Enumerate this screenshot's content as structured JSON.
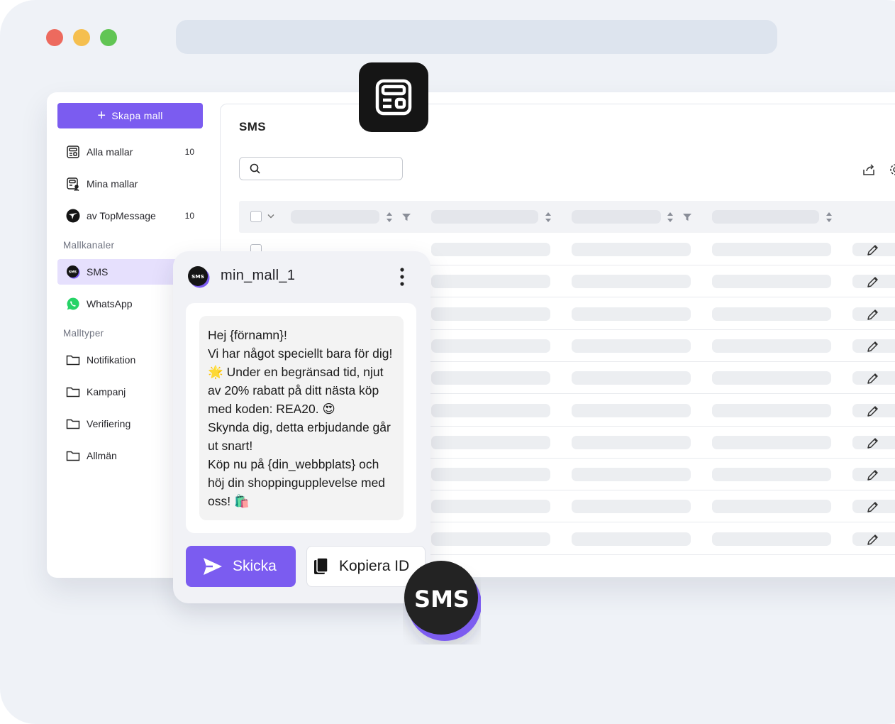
{
  "sidebar": {
    "create_label": "Skapa mall",
    "items": [
      {
        "label": "Alla mallar",
        "count": "10"
      },
      {
        "label": "Mina mallar"
      },
      {
        "label": "av TopMessage",
        "count": "10"
      }
    ],
    "channels_label": "Mallkanaler",
    "channels": [
      {
        "label": "SMS",
        "icon_text": "SMS"
      },
      {
        "label": "WhatsApp"
      }
    ],
    "types_label": "Malltyper",
    "types": [
      {
        "label": "Notifikation"
      },
      {
        "label": "Kampanj"
      },
      {
        "label": "Verifiering"
      },
      {
        "label": "Allmän"
      }
    ]
  },
  "main": {
    "title": "SMS",
    "search_value": "",
    "search_placeholder": "",
    "row_count": 10
  },
  "card": {
    "avatar_text": "SMS",
    "title": "min_mall_1",
    "message": "Hej {förnamn}!\nVi har något speciellt bara för dig! 🌟 Under en begränsad tid, njut av 20% rabatt på ditt nästa köp med koden: REA20. 😍\nSkynda dig, detta erbjudande går ut snart!\nKöp nu på {din_webbplats} och höj din shoppingupplevelse med oss! 🛍️",
    "send_label": "Skicka",
    "copy_label": "Kopiera ID"
  },
  "badge": {
    "text": "SMS"
  },
  "colors": {
    "accent": "#7b5cf0",
    "accent_light": "#e6e0fd",
    "background": "#eff2f7",
    "dark": "#151515",
    "whatsapp": "#25d366"
  }
}
